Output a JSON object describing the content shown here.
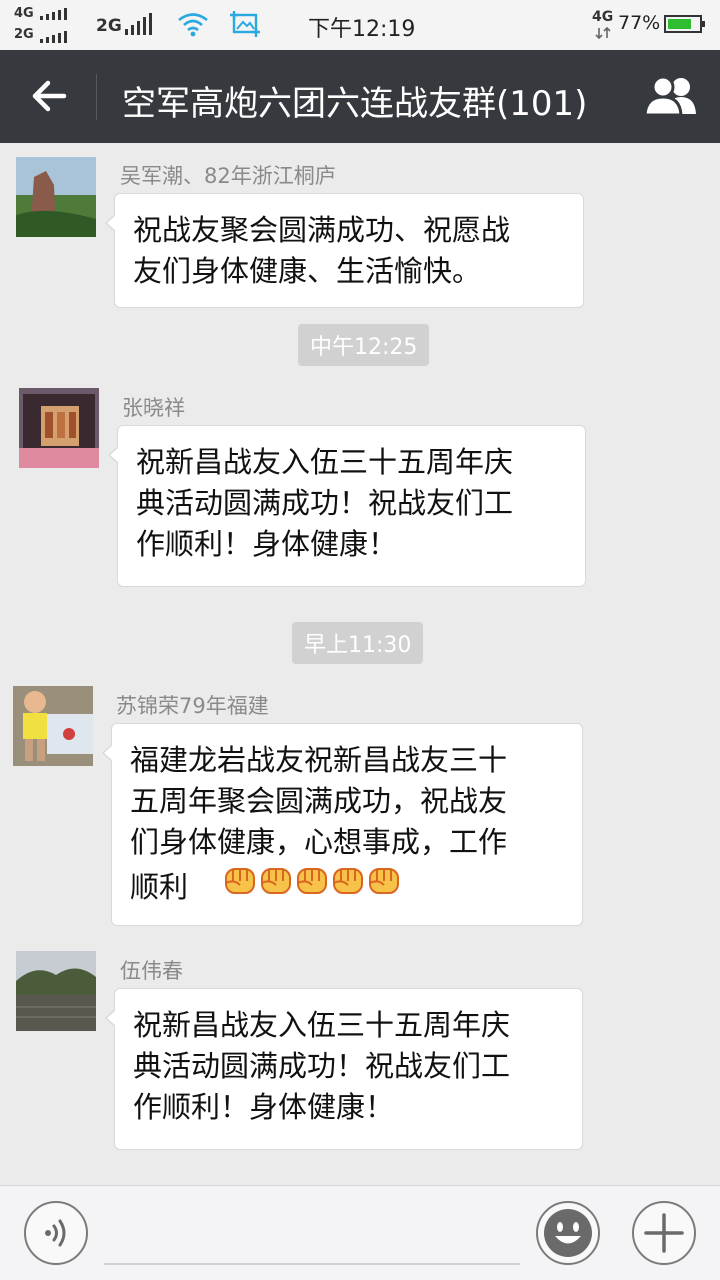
{
  "status_bar": {
    "sig1": "4G",
    "sig2": "2G",
    "sig3": "2G",
    "time": "下午12:19",
    "net": "4G",
    "battery": "77%",
    "battery_level": 0.77
  },
  "header": {
    "title": "空军高炮六团六连战友群(101)",
    "back_icon": "back-arrow-icon",
    "members_icon": "group-members-icon"
  },
  "messages": [
    {
      "sender": "吴军潮、82年浙江桐庐",
      "lines": [
        "祝战友聚会圆满成功、祝愿战",
        "友们身体健康、生活愉快。"
      ]
    },
    {
      "sender": "张晓祥",
      "lines": [
        "祝新昌战友入伍三十五周年庆",
        "典活动圆满成功！祝战友们工",
        "作顺利！身体健康！"
      ]
    },
    {
      "sender": "苏锦荣79年福建",
      "lines": [
        "福建龙岩战友祝新昌战友三十",
        "五周年聚会圆满成功，祝战友",
        "们身体健康，心想事成，工作",
        "顺利"
      ],
      "emoji_count": 5
    },
    {
      "sender": "伍伟春",
      "lines": [
        "祝新昌战友入伍三十五周年庆",
        "典活动圆满成功！祝战友们工",
        "作顺利！身体健康！"
      ]
    }
  ],
  "timestamps": [
    "中午12:25",
    "早上11:30"
  ],
  "bottom_bar": {
    "voice_icon": "voice-icon",
    "emoji_icon": "emoji-icon",
    "plus_icon": "plus-icon"
  },
  "colors": {
    "title_bar": "#36393e",
    "battery_fill": "#2fbd2f",
    "chat_bg": "#ebebeb"
  }
}
